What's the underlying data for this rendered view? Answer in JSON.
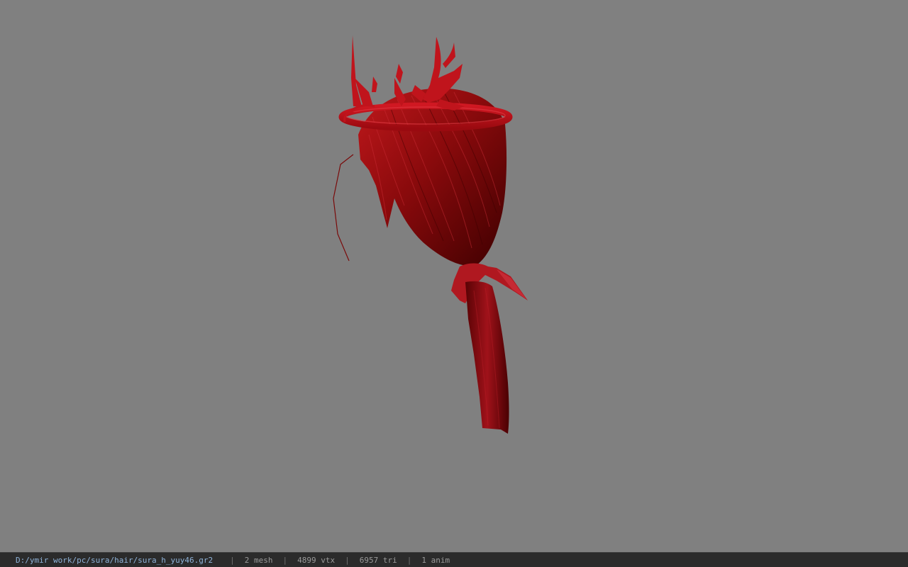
{
  "status_bar": {
    "file_path": "D:/ymir work/pc/sura/hair/sura_h_yuy46.gr2",
    "separator": "|",
    "mesh_count": "2 mesh",
    "vertex_count": "4899 vtx",
    "triangle_count": "6957 tri",
    "anim_count": "1 anim"
  },
  "colors": {
    "viewport_background": "#808080",
    "status_bar_background": "#2b2b2b",
    "path_text": "#8fb3d9",
    "stat_text": "#9a9a9a",
    "model_red": "#b01010"
  }
}
